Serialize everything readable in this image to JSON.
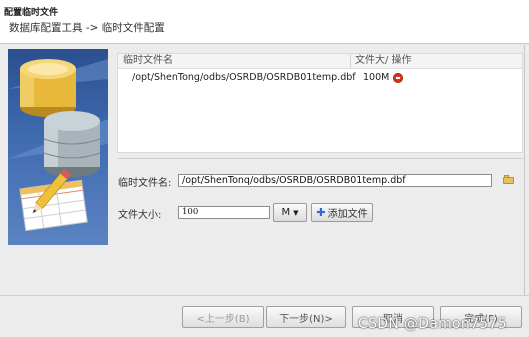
{
  "window": {
    "title": "配置临时文件",
    "breadcrumb": "数据库配置工具 -> 临时文件配置"
  },
  "table": {
    "columns": {
      "name": "临时文件名",
      "size_action": "文件大/ 操作"
    },
    "rows": [
      {
        "name": "/opt/ShenTong/odbs/OSRDB/OSRDB01temp.dbf",
        "size": "100M"
      }
    ]
  },
  "form": {
    "file_label": "临时文件名:",
    "file_value": "/opt/ShenTonq/odbs/OSRDB/OSRDB01temp.dbf",
    "size_label": "文件大小:",
    "size_value": "100",
    "unit": "M",
    "add_label": "添加文件"
  },
  "footer": {
    "prev": "<上一步(B)",
    "next": "下一步(N)>",
    "cancel": "取消",
    "finish": "完成(F)"
  },
  "watermark": "CSDN @Damon7575",
  "colors": {
    "remove_icon": "#d8351b",
    "folder_icon": "#e7c25a",
    "add_icon": "#2f6dc6"
  }
}
